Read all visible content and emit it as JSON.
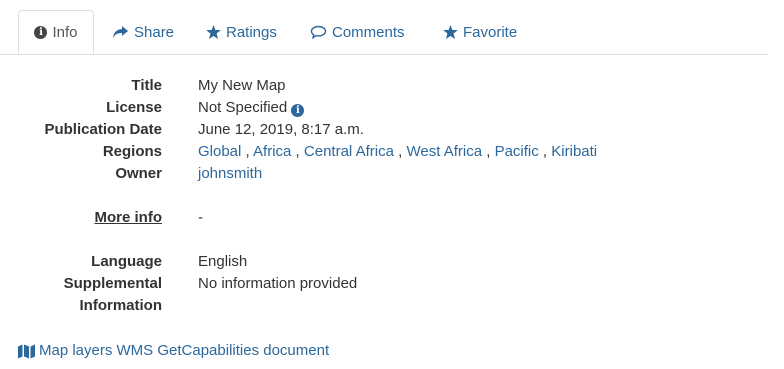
{
  "tabs": {
    "info": "Info",
    "share": "Share",
    "ratings": "Ratings",
    "comments": "Comments",
    "favorite": "Favorite"
  },
  "details": {
    "title_label": "Title",
    "title_value": "My New Map",
    "license_label": "License",
    "license_value": "Not Specified",
    "publication_label": "Publication Date",
    "publication_value": "June 12, 2019, 8:17 a.m.",
    "regions_label": "Regions",
    "regions": [
      "Global",
      "Africa",
      "Central Africa",
      "West Africa",
      "Pacific",
      "Kiribati"
    ],
    "owner_label": "Owner",
    "owner_value": "johnsmith",
    "more_info_label": "More info",
    "more_info_value": "-",
    "language_label": "Language",
    "language_value": "English",
    "supplemental_label_line1": "Supplemental",
    "supplemental_label_line2": "Information",
    "supplemental_value": "No information provided"
  },
  "wms_link": "Map layers WMS GetCapabilities document",
  "colors": {
    "link": "#2c689c",
    "text": "#333333",
    "border": "#dddddd"
  }
}
